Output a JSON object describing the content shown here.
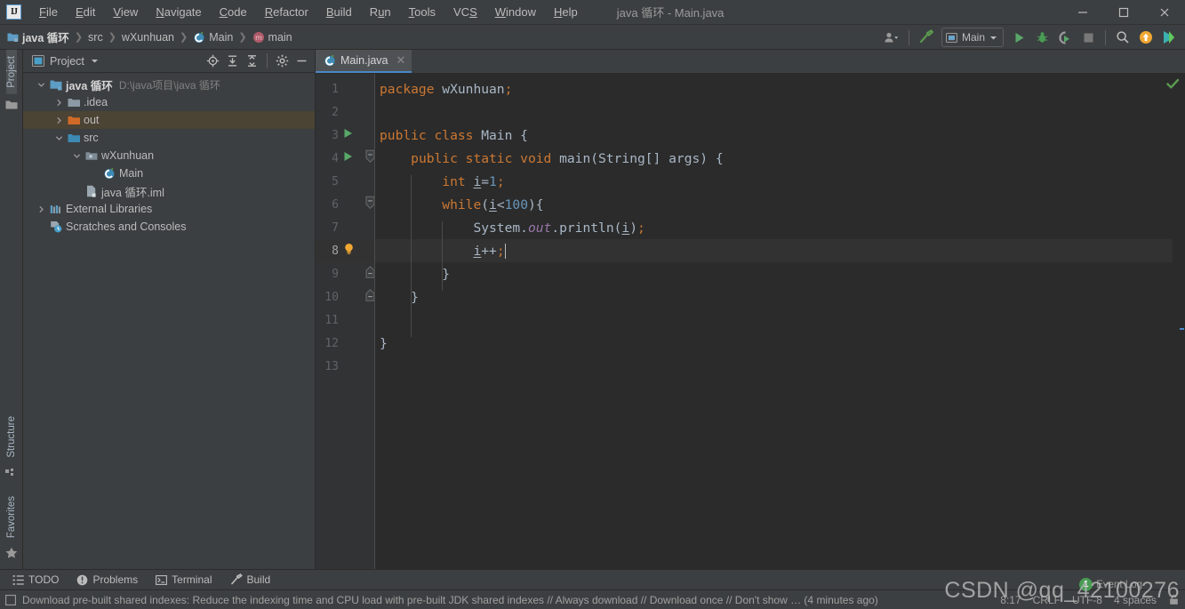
{
  "window": {
    "title": "java 循环 - Main.java",
    "logo_text": "IJ",
    "minimize_icon": "minimize-icon",
    "maximize_icon": "maximize-icon",
    "close_icon": "close-icon"
  },
  "menu": [
    {
      "label": "File",
      "mnemonic": "F"
    },
    {
      "label": "Edit",
      "mnemonic": "E"
    },
    {
      "label": "View",
      "mnemonic": "V"
    },
    {
      "label": "Navigate",
      "mnemonic": "N"
    },
    {
      "label": "Code",
      "mnemonic": "C"
    },
    {
      "label": "Refactor",
      "mnemonic": "R"
    },
    {
      "label": "Build",
      "mnemonic": "B"
    },
    {
      "label": "Run",
      "mnemonic": "u"
    },
    {
      "label": "Tools",
      "mnemonic": "T"
    },
    {
      "label": "VCS",
      "mnemonic": "S"
    },
    {
      "label": "Window",
      "mnemonic": "W"
    },
    {
      "label": "Help",
      "mnemonic": "H"
    }
  ],
  "breadcrumbs": [
    {
      "label": "java 循环",
      "icon": "project-icon",
      "bold": true
    },
    {
      "label": "src",
      "icon": "",
      "bold": false
    },
    {
      "label": "wXunhuan",
      "icon": "",
      "bold": false
    },
    {
      "label": "Main",
      "icon": "class-icon",
      "bold": false
    },
    {
      "label": "main",
      "icon": "method-icon",
      "bold": false
    }
  ],
  "toolbar": {
    "account_icon": "account-icon",
    "build_icon": "hammer-build-icon",
    "run_config": {
      "label": "Main",
      "icon": "run-config-icon",
      "chevron_icon": "chevron-down-icon"
    },
    "run_icon": "run-play-icon",
    "debug_icon": "debug-bug-icon",
    "run_coverage_icon": "run-with-coverage-icon",
    "stop_icon": "stop-square-icon",
    "search_icon": "search-icon",
    "update_icon": "update-arrow-icon",
    "ide_icon": "ide-play-icon"
  },
  "rail": {
    "left_top": [
      {
        "label": "Project",
        "icon": "project-folder-icon",
        "active": true
      }
    ],
    "left_bottom": [
      {
        "label": "Structure",
        "icon": "structure-icon",
        "active": false
      },
      {
        "label": "Favorites",
        "icon": "star-icon",
        "active": false
      }
    ]
  },
  "project_panel": {
    "title": "Project",
    "title_icon": "project-view-icon",
    "chevron_icon": "chevron-down-icon",
    "actions": [
      {
        "name": "locate-target-icon"
      },
      {
        "name": "expand-all-icon"
      },
      {
        "name": "collapse-all-icon"
      },
      {
        "name": "settings-gear-icon"
      },
      {
        "name": "hide-minimize-icon"
      }
    ],
    "tree": [
      {
        "label": "java 循环",
        "sub": "D:\\java项目\\java 循环",
        "depth": 0,
        "arrow": "down",
        "icon": "module-icon",
        "bold": true,
        "selected": false
      },
      {
        "label": ".idea",
        "sub": "",
        "depth": 1,
        "arrow": "right",
        "icon": "folder-icon",
        "bold": false,
        "selected": false
      },
      {
        "label": "out",
        "sub": "",
        "depth": 1,
        "arrow": "right",
        "icon": "folder-orange-icon",
        "bold": false,
        "selected": true
      },
      {
        "label": "src",
        "sub": "",
        "depth": 1,
        "arrow": "down",
        "icon": "folder-src-icon",
        "bold": false,
        "selected": false
      },
      {
        "label": "wXunhuan",
        "sub": "",
        "depth": 2,
        "arrow": "down",
        "icon": "package-icon",
        "bold": false,
        "selected": false
      },
      {
        "label": "Main",
        "sub": "",
        "depth": 3,
        "arrow": "",
        "icon": "class-icon",
        "bold": false,
        "selected": false
      },
      {
        "label": "java 循环.iml",
        "sub": "",
        "depth": 2,
        "arrow": "",
        "icon": "iml-file-icon",
        "bold": false,
        "selected": false
      },
      {
        "label": "External Libraries",
        "sub": "",
        "depth": 0,
        "arrow": "right",
        "icon": "libraries-icon",
        "bold": false,
        "selected": false
      },
      {
        "label": "Scratches and Consoles",
        "sub": "",
        "depth": 0,
        "arrow": "",
        "icon": "scratches-icon",
        "bold": false,
        "selected": false
      }
    ]
  },
  "editor": {
    "tabs": [
      {
        "label": "Main.java",
        "icon": "java-class-icon",
        "active": true,
        "close_icon": "close-icon"
      }
    ],
    "inspection_status_icon": "inspection-ok-check-icon",
    "current_line": 8,
    "lines": [
      {
        "n": 1,
        "run": false,
        "bulb": false,
        "fold": "",
        "indent": 1,
        "tokens": [
          {
            "t": "package ",
            "c": "k"
          },
          {
            "t": "wXunhuan",
            "c": "pl"
          },
          {
            "t": ";",
            "c": "sem"
          }
        ]
      },
      {
        "n": 2,
        "run": false,
        "bulb": false,
        "fold": "",
        "indent": 0,
        "tokens": []
      },
      {
        "n": 3,
        "run": true,
        "bulb": false,
        "fold": "",
        "indent": 1,
        "tokens": [
          {
            "t": "public class ",
            "c": "k"
          },
          {
            "t": "Main ",
            "c": "pl"
          },
          {
            "t": "{",
            "c": "brace"
          }
        ]
      },
      {
        "n": 4,
        "run": true,
        "bulb": false,
        "fold": "top",
        "indent": 2,
        "tokens": [
          {
            "t": "public static void ",
            "c": "k"
          },
          {
            "t": "main",
            "c": "pl"
          },
          {
            "t": "(",
            "c": "brace"
          },
          {
            "t": "String",
            "c": "pl"
          },
          {
            "t": "[] args",
            "c": "pl"
          },
          {
            "t": ") ",
            "c": "brace"
          },
          {
            "t": "{",
            "c": "brace"
          }
        ]
      },
      {
        "n": 5,
        "run": false,
        "bulb": false,
        "fold": "",
        "indent": 3,
        "tokens": [
          {
            "t": "int ",
            "c": "k"
          },
          {
            "t": "i",
            "c": "var-u"
          },
          {
            "t": "=",
            "c": "pl"
          },
          {
            "t": "1",
            "c": "num-lit"
          },
          {
            "t": ";",
            "c": "sem"
          }
        ]
      },
      {
        "n": 6,
        "run": false,
        "bulb": false,
        "fold": "top",
        "indent": 3,
        "tokens": [
          {
            "t": "while",
            "c": "k"
          },
          {
            "t": "(",
            "c": "brace"
          },
          {
            "t": "i",
            "c": "var-u"
          },
          {
            "t": "<",
            "c": "pl"
          },
          {
            "t": "100",
            "c": "num-lit"
          },
          {
            "t": ")",
            "c": "brace"
          },
          {
            "t": "{",
            "c": "brace"
          }
        ]
      },
      {
        "n": 7,
        "run": false,
        "bulb": false,
        "fold": "",
        "indent": 4,
        "tokens": [
          {
            "t": "System",
            "c": "pl"
          },
          {
            "t": ".",
            "c": "pl"
          },
          {
            "t": "out",
            "c": "fld"
          },
          {
            "t": ".",
            "c": "pl"
          },
          {
            "t": "println",
            "c": "pl"
          },
          {
            "t": "(",
            "c": "brace"
          },
          {
            "t": "i",
            "c": "var-u"
          },
          {
            "t": ")",
            "c": "brace"
          },
          {
            "t": ";",
            "c": "sem"
          }
        ]
      },
      {
        "n": 8,
        "run": false,
        "bulb": true,
        "fold": "",
        "indent": 4,
        "tokens": [
          {
            "t": "i",
            "c": "var-u"
          },
          {
            "t": "++",
            "c": "pl"
          },
          {
            "t": ";",
            "c": "sem"
          }
        ],
        "caret": true
      },
      {
        "n": 9,
        "run": false,
        "bulb": false,
        "fold": "bottom",
        "indent": 3,
        "tokens": [
          {
            "t": "}",
            "c": "brace"
          }
        ]
      },
      {
        "n": 10,
        "run": false,
        "bulb": false,
        "fold": "bottom",
        "indent": 2,
        "tokens": [
          {
            "t": "}",
            "c": "brace"
          }
        ]
      },
      {
        "n": 11,
        "run": false,
        "bulb": false,
        "fold": "",
        "indent": 0,
        "tokens": []
      },
      {
        "n": 12,
        "run": false,
        "bulb": false,
        "fold": "",
        "indent": 1,
        "tokens": [
          {
            "t": "}",
            "c": "brace"
          }
        ]
      },
      {
        "n": 13,
        "run": false,
        "bulb": false,
        "fold": "",
        "indent": 0,
        "tokens": []
      }
    ]
  },
  "bottom_tools": [
    {
      "label": "TODO",
      "icon": "todo-list-icon"
    },
    {
      "label": "Problems",
      "icon": "problems-warning-icon"
    },
    {
      "label": "Terminal",
      "icon": "terminal-icon"
    },
    {
      "label": "Build",
      "icon": "build-hammer-icon"
    }
  ],
  "statusbar": {
    "notification_icon": "notification-box-icon",
    "message": "Download pre-built shared indexes: Reduce the indexing time and CPU load with pre-built JDK shared indexes // Always download // Download once // Don't show … (4 minutes ago)",
    "caret_position": "8:17",
    "line_separator": "CRLF",
    "encoding": "UTF-8",
    "indent": "4 spaces",
    "lock_icon": "read-only-lock-icon",
    "event_log": {
      "label": "Event Log",
      "count": "1"
    }
  },
  "watermark": "CSDN @qq_42100276",
  "colors": {
    "chrome": "#3c3f41",
    "editor_bg": "#2b2b2b",
    "gutter_bg": "#313335",
    "current_line": "#323232",
    "tab_active_underline": "#4a88c7",
    "selection_tree": "#4b4334",
    "keyword": "#cc7832",
    "number": "#6897bb",
    "field": "#9876aa",
    "plain": "#a9b7c6",
    "run_green": "#499c54",
    "bulb_yellow": "#f0a732"
  }
}
